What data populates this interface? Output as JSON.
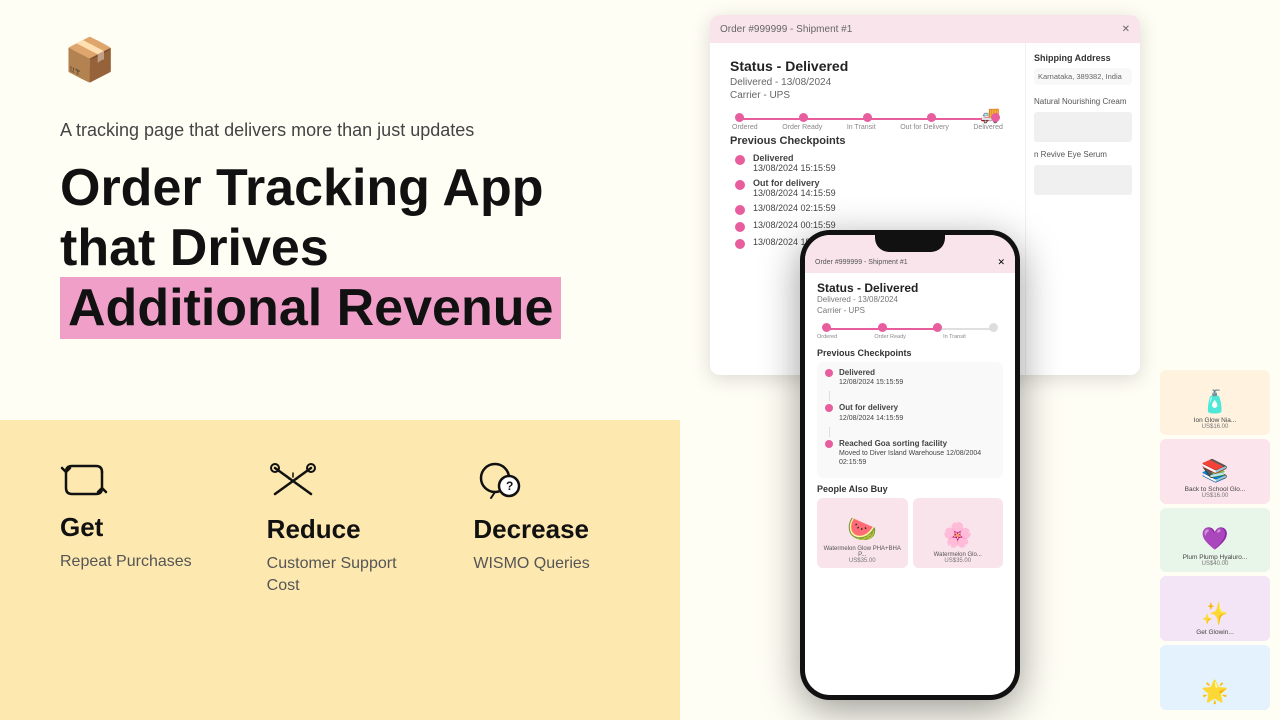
{
  "logo": {
    "emoji": "📦",
    "alt": "Order Tracking App Logo"
  },
  "tagline": "A tracking page that delivers more than just updates",
  "headline": {
    "line1": "Order Tracking App that Drives",
    "line2": "Additional Revenue"
  },
  "features": [
    {
      "id": "get",
      "icon_label": "repeat-icon",
      "label": "Get",
      "description": "Repeat Purchases"
    },
    {
      "id": "reduce",
      "icon_label": "handshake-icon",
      "label": "Reduce",
      "description": "Customer Support Cost"
    },
    {
      "id": "decrease",
      "icon_label": "question-chat-icon",
      "label": "Decrease",
      "description": "WISMO Queries"
    }
  ],
  "desktop_app": {
    "titlebar": "Order #999999 - Shipment #1",
    "status": "Status - Delivered",
    "delivered_date": "Delivered - 13/08/2024",
    "carrier": "Carrier - UPS",
    "tracking_steps": [
      "Ordered",
      "Order Ready",
      "In Transit",
      "Out for Delivery",
      "Delivered"
    ],
    "section_title": "Previous Checkpoints",
    "checkpoints": [
      {
        "label": "Delivered",
        "date": "13/08/2024  15:15:59"
      },
      {
        "label": "Out for delivery",
        "date": "13/08/2024  14:15:59"
      },
      {
        "label": "13/08/2024  02:15:59",
        "sub": ""
      },
      {
        "label": "13/08/2024  00:15:59",
        "sub": ""
      },
      {
        "label": "13/08/2024  19:15:59",
        "sub": ""
      }
    ],
    "shipping_address": "Shipping Address",
    "shipping_detail": "Karnataka, 389382, India",
    "products": [
      "Natural Nourishing Cream",
      "n Revive Eye Serum"
    ]
  },
  "mobile_app": {
    "titlebar": "Order #999999 - Shipment #1",
    "status": "Status - Delivered",
    "delivered_date": "Delivered - 13/08/2024",
    "carrier": "Carrier - UPS",
    "tracking_steps": [
      "Ordered",
      "Order Ready",
      "In Transit"
    ],
    "section_title": "Previous Checkpoints",
    "checkpoints": [
      {
        "label": "Delivered",
        "date": "12/08/2024  15:15:59"
      },
      {
        "label": "Out for delivery",
        "date": "12/08/2024  14:15:59"
      },
      {
        "label": "Reached Goa sorting facility",
        "detail": "Moved to Diver Island Warehouse  12/08/2024  02:15:59"
      }
    ],
    "people_also_buy": "People Also Buy",
    "products": [
      {
        "name": "Watermelon Glow PHA+BHA P...",
        "price": "US$35.00",
        "emoji": "🍉"
      },
      {
        "name": "Watermelon Glo...",
        "price": "US$35.00",
        "emoji": "🌸"
      }
    ]
  },
  "side_products": [
    {
      "name": "Ion Glow Nia...",
      "price": "US$16.00",
      "emoji": "🧴"
    },
    {
      "name": "Back to School Glo...",
      "price": "US$16.00",
      "emoji": "📚"
    },
    {
      "name": "Plum Plump Hyaluro...",
      "price": "US$40.00",
      "emoji": "💜"
    },
    {
      "name": "Get Glowin...",
      "emoji": "✨"
    },
    {
      "name": "",
      "emoji": ""
    }
  ]
}
